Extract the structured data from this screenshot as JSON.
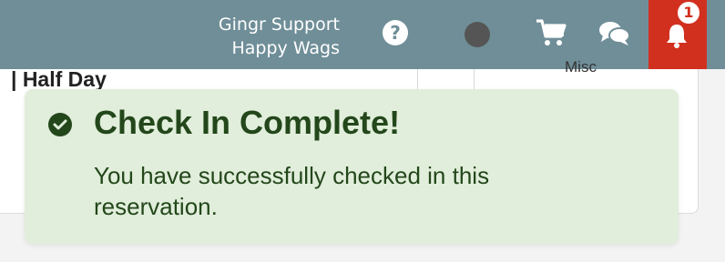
{
  "header": {
    "user_name": "Gingr Support",
    "location_name": "Happy Wags",
    "icons": [
      "help-icon",
      "status-dot",
      "cart-icon",
      "chat-icon",
      "bell-icon"
    ],
    "notification_count": "1",
    "colors": {
      "bar": "#6f8e98",
      "alert": "#d2301f"
    }
  },
  "background": {
    "reservation_label": "| Half Day",
    "column_text": "Misc"
  },
  "toast": {
    "title": "Check In Complete!",
    "message": "You have successfully checked in this reservation.",
    "icon": "check-circle-icon",
    "colors": {
      "background": "#e1eedb",
      "text": "#23471b"
    }
  }
}
